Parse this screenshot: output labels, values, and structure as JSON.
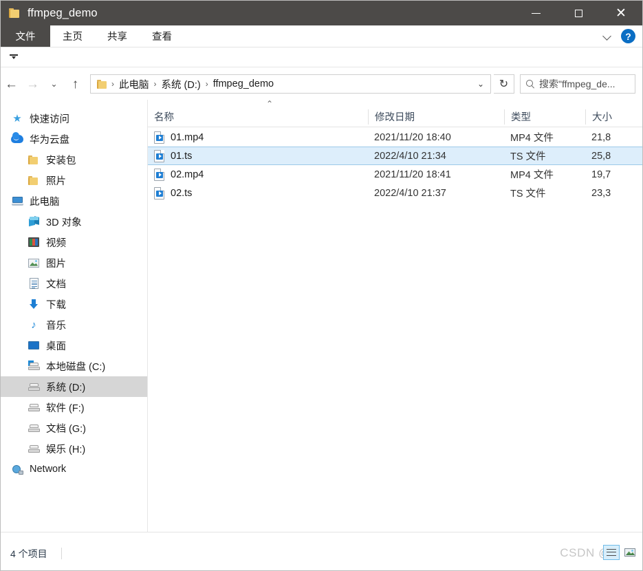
{
  "window": {
    "title": "ffmpeg_demo",
    "folder_icon": "folder-icon",
    "minimize_label": "—",
    "maximize_label": "☐",
    "close_label": "✕"
  },
  "ribbon": {
    "tabs": [
      {
        "label": "文件",
        "name": "tab-file",
        "active": true
      },
      {
        "label": "主页",
        "name": "tab-home",
        "active": false
      },
      {
        "label": "共享",
        "name": "tab-share",
        "active": false
      },
      {
        "label": "查看",
        "name": "tab-view",
        "active": false
      }
    ],
    "collapse_icon": "chevron-down-icon",
    "help_label": "?"
  },
  "nav": {
    "back_label": "←",
    "forward_label": "→",
    "recent_label": "⌄",
    "up_label": "↑",
    "refresh_label": "↻",
    "dropdown_label": "⌄",
    "breadcrumb": [
      {
        "label": "此电脑",
        "name": "breadcrumb-this-pc"
      },
      {
        "label": "系统 (D:)",
        "name": "breadcrumb-drive-d"
      },
      {
        "label": "ffmpeg_demo",
        "name": "breadcrumb-ffmpeg-demo"
      }
    ],
    "separator": "›"
  },
  "search": {
    "placeholder": "搜索\"ffmpeg_de...",
    "icon": "search-icon"
  },
  "sidebar": {
    "items": [
      {
        "label": "快速访问",
        "icon": "star-icon",
        "level": 0,
        "name": "sidebar-item-quick-access",
        "selected": false
      },
      {
        "label": "华为云盘",
        "icon": "cloud-icon",
        "level": 0,
        "name": "sidebar-item-huawei-cloud",
        "selected": false
      },
      {
        "label": "安装包",
        "icon": "folder-icon",
        "level": 1,
        "name": "sidebar-item-installers",
        "selected": false
      },
      {
        "label": "照片",
        "icon": "folder-icon",
        "level": 1,
        "name": "sidebar-item-photos",
        "selected": false
      },
      {
        "label": "此电脑",
        "icon": "this-pc-icon",
        "level": 0,
        "name": "sidebar-item-this-pc",
        "selected": false
      },
      {
        "label": "3D 对象",
        "icon": "3d-objects-icon",
        "level": 1,
        "name": "sidebar-item-3d-objects",
        "selected": false
      },
      {
        "label": "视频",
        "icon": "videos-icon",
        "level": 1,
        "name": "sidebar-item-videos",
        "selected": false
      },
      {
        "label": "图片",
        "icon": "pictures-icon",
        "level": 1,
        "name": "sidebar-item-pictures",
        "selected": false
      },
      {
        "label": "文档",
        "icon": "documents-icon",
        "level": 1,
        "name": "sidebar-item-documents",
        "selected": false
      },
      {
        "label": "下载",
        "icon": "downloads-icon",
        "level": 1,
        "name": "sidebar-item-downloads",
        "selected": false
      },
      {
        "label": "音乐",
        "icon": "music-icon",
        "level": 1,
        "name": "sidebar-item-music",
        "selected": false
      },
      {
        "label": "桌面",
        "icon": "desktop-icon",
        "level": 1,
        "name": "sidebar-item-desktop",
        "selected": false
      },
      {
        "label": "本地磁盘 (C:)",
        "icon": "system-drive-icon",
        "level": 1,
        "name": "sidebar-item-local-disk-c",
        "selected": false
      },
      {
        "label": "系统 (D:)",
        "icon": "drive-icon",
        "level": 1,
        "name": "sidebar-item-drive-d",
        "selected": true
      },
      {
        "label": "软件 (F:)",
        "icon": "drive-icon",
        "level": 1,
        "name": "sidebar-item-drive-f",
        "selected": false
      },
      {
        "label": "文档 (G:)",
        "icon": "drive-icon",
        "level": 1,
        "name": "sidebar-item-drive-g",
        "selected": false
      },
      {
        "label": "娱乐 (H:)",
        "icon": "drive-icon",
        "level": 1,
        "name": "sidebar-item-drive-h",
        "selected": false
      },
      {
        "label": "Network",
        "icon": "network-icon",
        "level": 0,
        "name": "sidebar-item-network",
        "selected": false
      }
    ]
  },
  "filelist": {
    "sort_indicator": "⌃",
    "columns": [
      {
        "label": "名称",
        "name": "column-header-name",
        "key": "c-name"
      },
      {
        "label": "修改日期",
        "name": "column-header-date-modified",
        "key": "c-date"
      },
      {
        "label": "类型",
        "name": "column-header-type",
        "key": "c-type"
      },
      {
        "label": "大小",
        "name": "column-header-size",
        "key": "c-size"
      }
    ],
    "rows": [
      {
        "name": "01.mp4",
        "date": "2021/11/20 18:40",
        "type": "MP4 文件",
        "size": "21,8",
        "selected": false
      },
      {
        "name": "01.ts",
        "date": "2022/4/10 21:34",
        "type": "TS 文件",
        "size": "25,8",
        "selected": true
      },
      {
        "name": "02.mp4",
        "date": "2021/11/20 18:41",
        "type": "MP4 文件",
        "size": "19,7",
        "selected": false
      },
      {
        "name": "02.ts",
        "date": "2022/4/10 21:37",
        "type": "TS 文件",
        "size": "23,3",
        "selected": false
      }
    ]
  },
  "scrollbar": {
    "left_arrow": "‹",
    "right_arrow": "›"
  },
  "statusbar": {
    "item_count": "4 个项目",
    "watermark": "CSDN @",
    "details_view_name": "details-view-button",
    "thumbnail_view_name": "thumbnail-view-button"
  },
  "colors": {
    "titlebar": "#4c4a48",
    "accent": "#0b6ec4",
    "selection": "#ddeefb",
    "selection_border": "#9cc9e8",
    "sidebar_selected": "#d6d6d6",
    "folder_yellow": "#f2ce71"
  }
}
